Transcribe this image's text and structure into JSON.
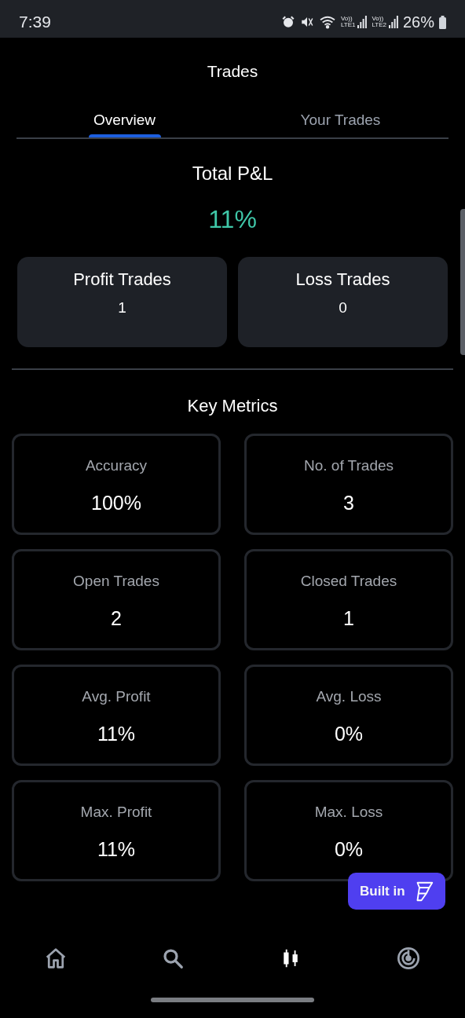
{
  "status_bar": {
    "time": "7:39",
    "sim_labels": [
      {
        "top": "Vo))",
        "bottom": "LTE1"
      },
      {
        "top": "Vo))",
        "bottom": "LTE2"
      }
    ],
    "battery": "26%"
  },
  "header": {
    "title": "Trades"
  },
  "tabs": [
    {
      "label": "Overview",
      "selected": true
    },
    {
      "label": "Your Trades",
      "selected": false
    }
  ],
  "summary": {
    "title": "Total P&L",
    "value": "11%"
  },
  "trade_counts": [
    {
      "label": "Profit Trades",
      "value": "1"
    },
    {
      "label": "Loss Trades",
      "value": "0"
    }
  ],
  "key_metrics": {
    "title": "Key Metrics",
    "items": [
      {
        "label": "Accuracy",
        "value": "100%"
      },
      {
        "label": "No. of Trades",
        "value": "3"
      },
      {
        "label": "Open Trades",
        "value": "2"
      },
      {
        "label": "Closed Trades",
        "value": "1"
      },
      {
        "label": "Avg. Profit",
        "value": "11%"
      },
      {
        "label": "Avg. Loss",
        "value": "0%"
      },
      {
        "label": "Max. Profit",
        "value": "11%"
      },
      {
        "label": "Max. Loss",
        "value": "0%"
      }
    ]
  },
  "badge": {
    "label": "Built in"
  },
  "bottom_nav": [
    {
      "kind": "home",
      "selected": false
    },
    {
      "kind": "search",
      "selected": false
    },
    {
      "kind": "trades",
      "selected": true
    },
    {
      "kind": "radar",
      "selected": false
    }
  ]
}
